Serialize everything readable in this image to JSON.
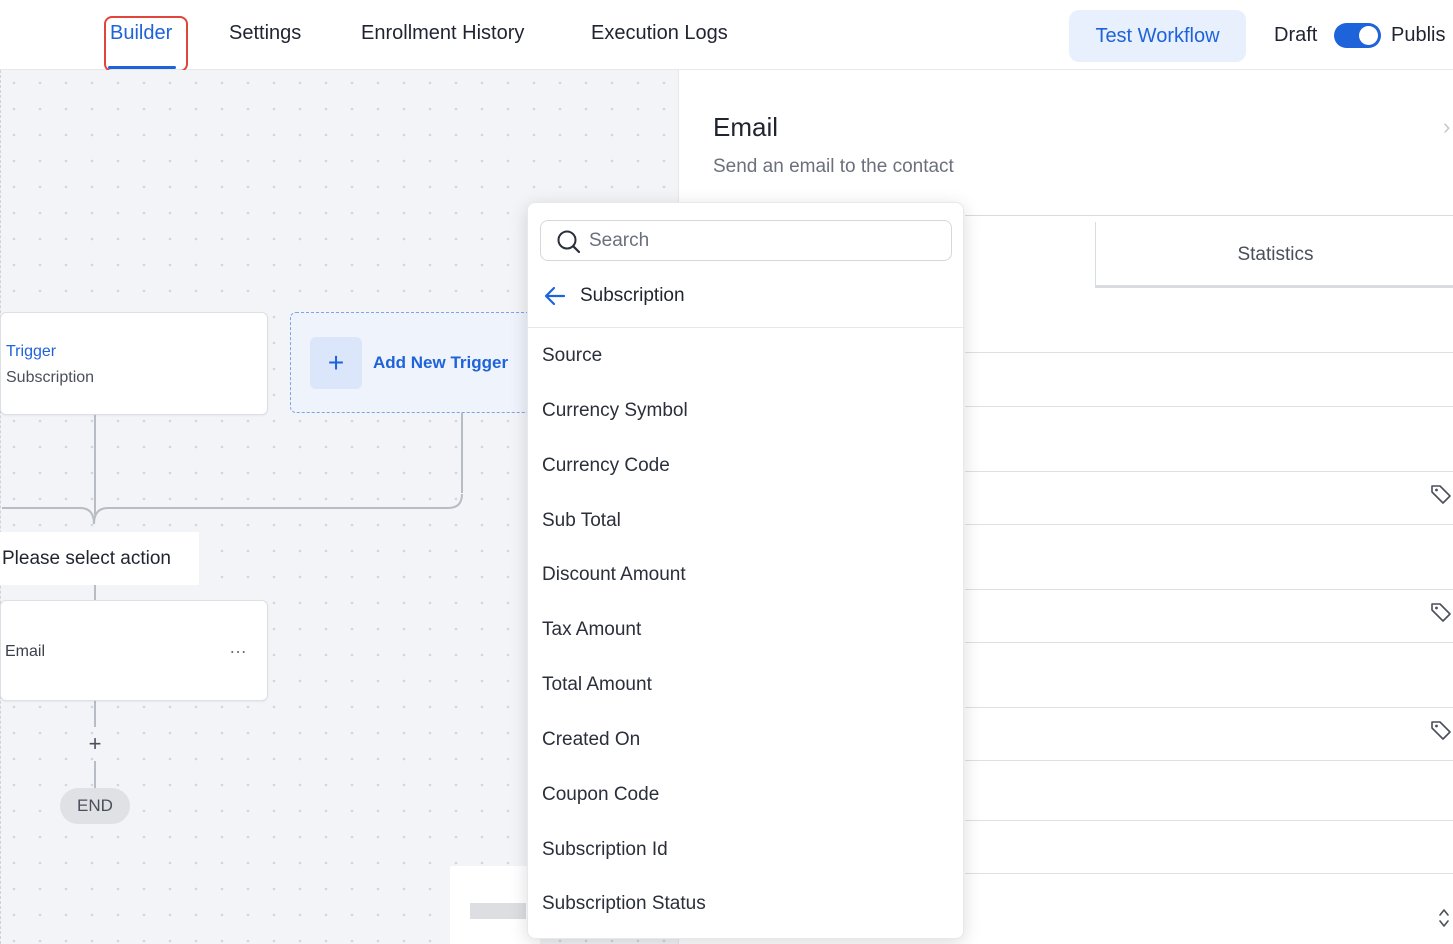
{
  "nav": {
    "tabs": [
      "Builder",
      "Settings",
      "Enrollment History",
      "Execution Logs"
    ],
    "test_button": "Test Workflow",
    "draft_label": "Draft",
    "publish_label": "Publis"
  },
  "canvas": {
    "trigger_title": "Trigger",
    "trigger_subtitle": "Subscription",
    "add_trigger_label": "Add New Trigger",
    "plus_glyph": "+",
    "select_action_label": "Please select action",
    "email_node_label": "Email",
    "more_glyph": "…",
    "add_step_glyph": "+",
    "end_label": "END"
  },
  "panel": {
    "title": "Email",
    "subtitle": "Send an email to the contact",
    "statistics_tab": "Statistics",
    "close_glyph": "›"
  },
  "dropdown": {
    "search_placeholder": "Search",
    "back_label": "Subscription",
    "options": [
      "Source",
      "Currency Symbol",
      "Currency Code",
      "Sub Total",
      "Discount Amount",
      "Tax Amount",
      "Total Amount",
      "Created On",
      "Coupon Code",
      "Subscription Id",
      "Subscription Status"
    ]
  },
  "colors": {
    "accent": "#1e63d9",
    "highlight_border": "#e0453b",
    "canvas_bg": "#f3f4f7"
  },
  "icons": {
    "search": "search-icon",
    "back": "arrow-left-icon",
    "tag": "tag-icon",
    "updown": "chevron-up-down-icon"
  }
}
